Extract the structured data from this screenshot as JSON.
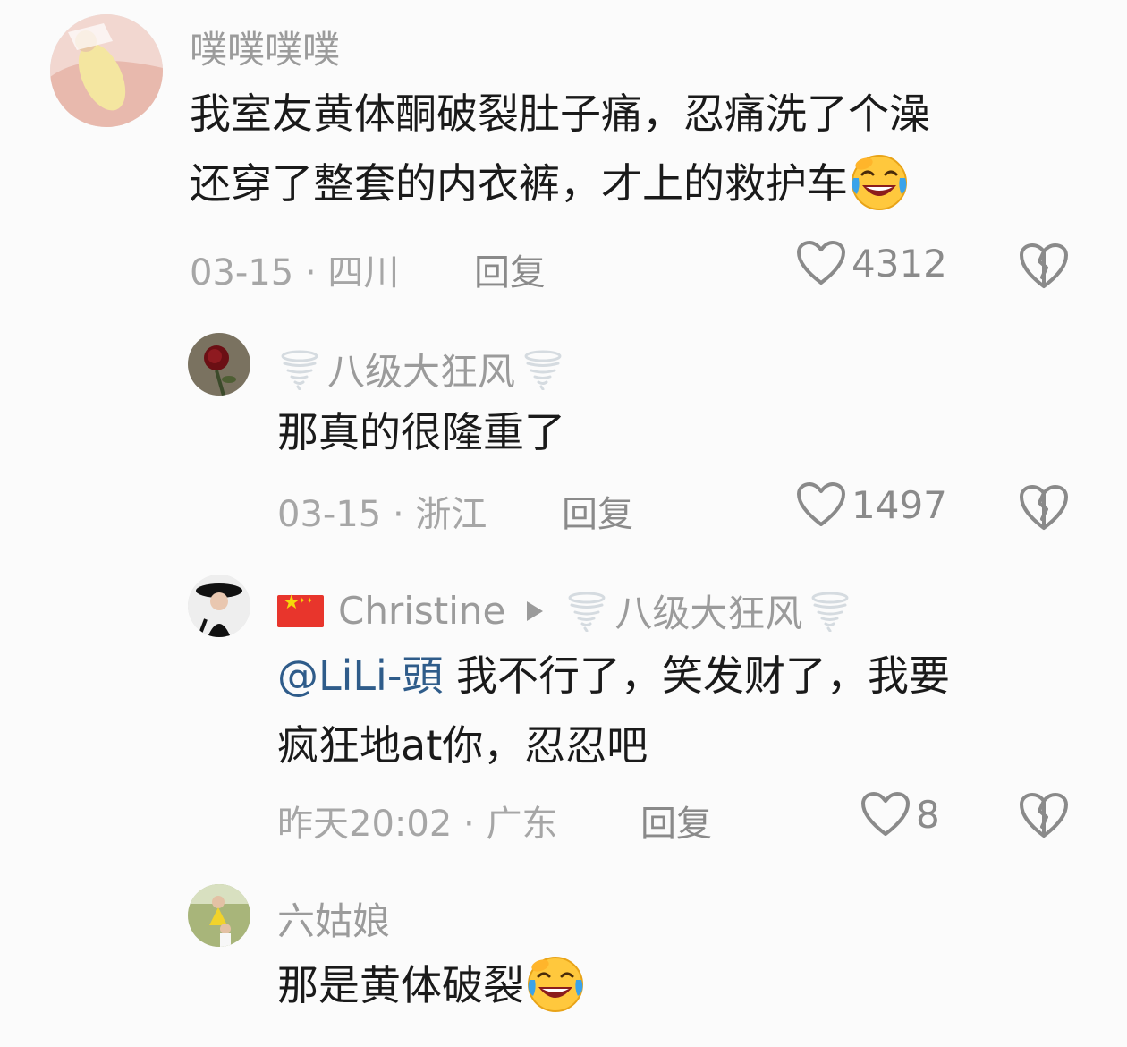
{
  "comments": [
    {
      "username": "噗噗噗噗",
      "text_lines": [
        "我室友黄体酮破裂肚子痛，忍痛洗了个澡",
        "还穿了整套的内衣裤，才上的救护车"
      ],
      "emoji": "laughing-crying-emoji",
      "date": "03-15",
      "location": "四川",
      "reply_label": "回复",
      "likes": "4312"
    },
    {
      "username": "八级大狂风",
      "text_lines": [
        "那真的很隆重了"
      ],
      "date": "03-15",
      "location": "浙江",
      "reply_label": "回复",
      "likes": "1497"
    },
    {
      "username": "Christine",
      "reply_to": "八级大狂风",
      "mention": "@LiLi-頭",
      "text_first": "我不行了，笑发财了，我要",
      "text_second": "疯狂地at你，忍忍吧",
      "date": "昨天20:02",
      "location": "广东",
      "reply_label": "回复",
      "likes": "8"
    },
    {
      "username": "六姑娘",
      "text_lines": [
        "那是黄体破裂"
      ],
      "emoji": "laughing-crying-emoji"
    }
  ],
  "separator": " · ",
  "icons": {
    "like": "heart-outline-icon",
    "dislike": "broken-heart-icon",
    "user_decoration": "tornado-icon",
    "flag": "china-flag-icon"
  },
  "colors": {
    "mention": "#2f5c8a",
    "meta": "#a6a6a6",
    "username": "#9b9b9b"
  }
}
